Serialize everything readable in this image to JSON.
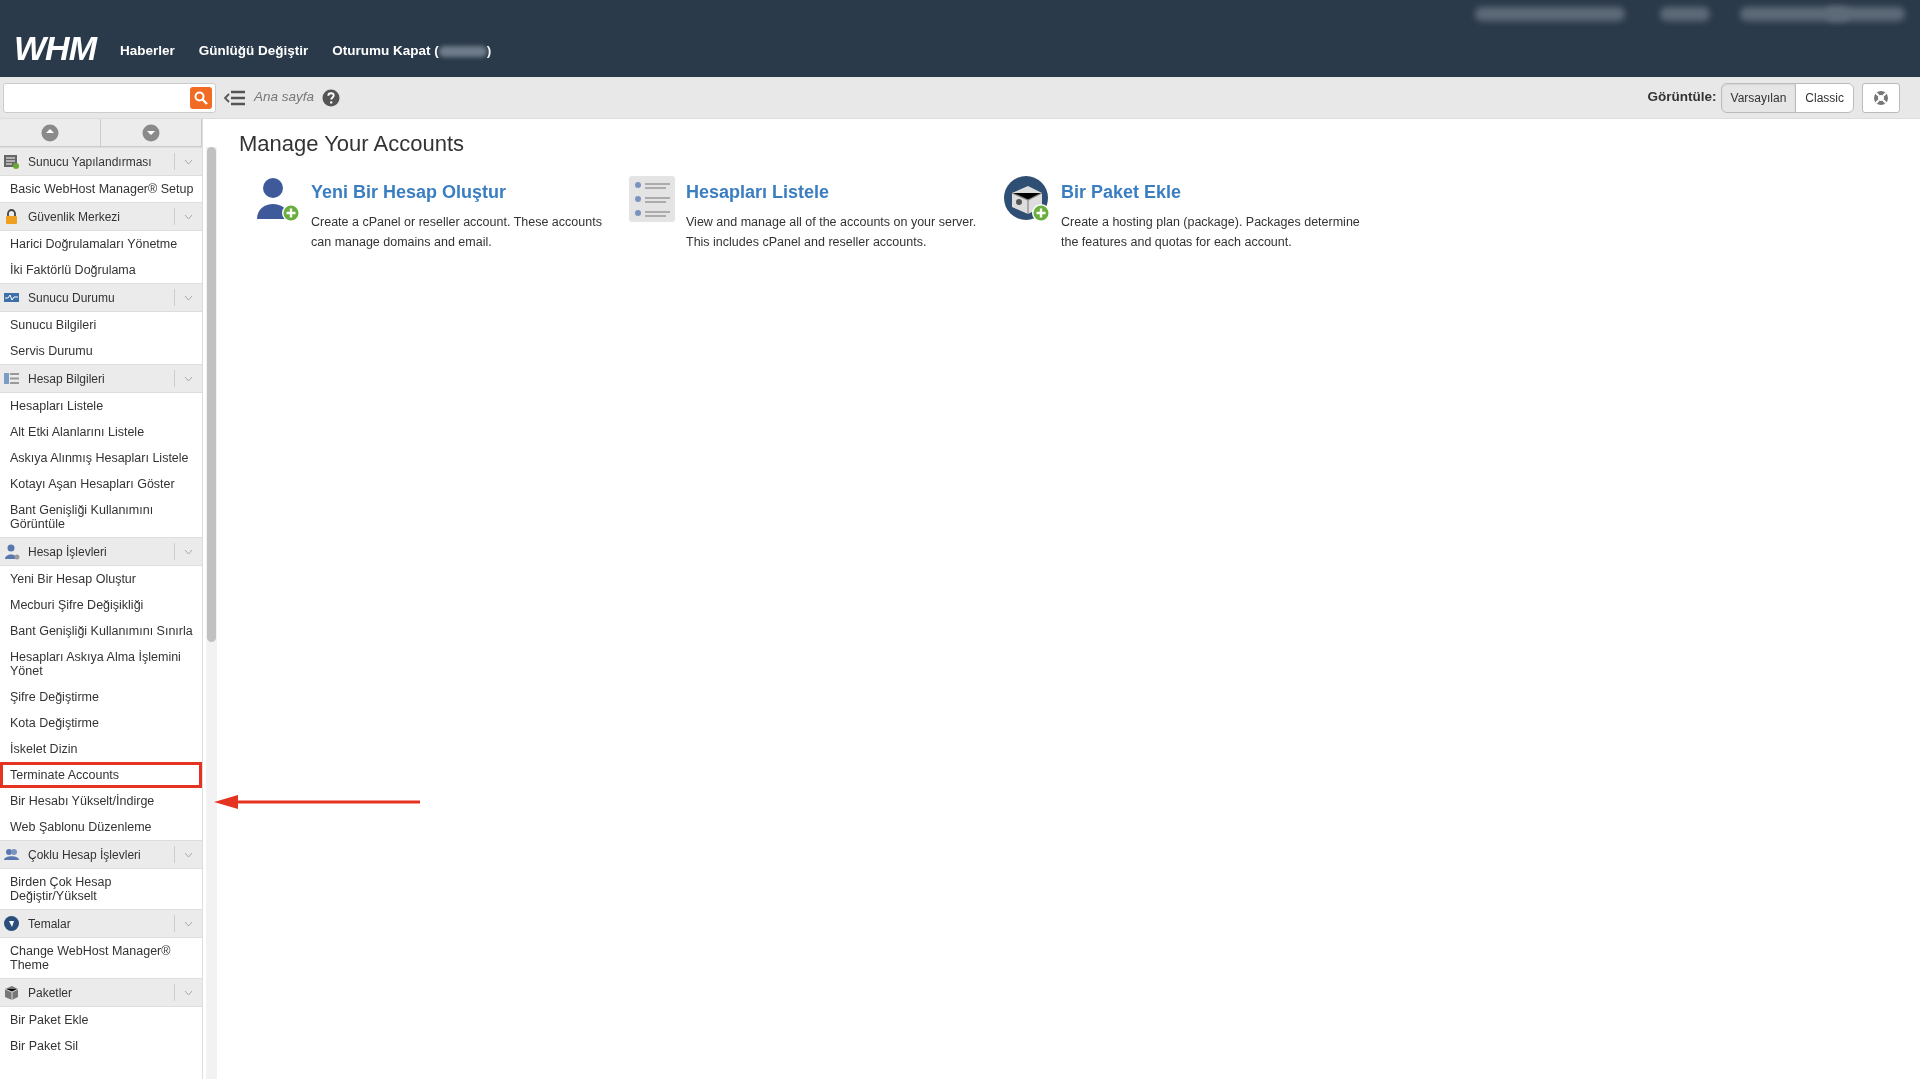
{
  "header": {
    "logo": "WHM",
    "nav": [
      "Haberler",
      "Günlüğü Değiştir"
    ],
    "logout_prefix": "Oturumu Kapat (",
    "logout_suffix": ")"
  },
  "toolbar": {
    "breadcrumb": "Ana sayfa",
    "view_label": "Görüntüle:",
    "view_options": [
      {
        "label": "Varsayılan",
        "selected": true
      },
      {
        "label": "Classic",
        "selected": false
      }
    ]
  },
  "sidebar": {
    "sections": [
      {
        "title": "Sunucu Yapılandırması",
        "items": [
          {
            "label": "Basic WebHost Manager® Setup",
            "highlighted": false
          }
        ]
      },
      {
        "title": "Güvenlik Merkezi",
        "items": [
          {
            "label": "Harici Doğrulamaları Yönetme",
            "highlighted": false
          },
          {
            "label": "İki Faktörlü Doğrulama",
            "highlighted": false
          }
        ]
      },
      {
        "title": "Sunucu Durumu",
        "items": [
          {
            "label": "Sunucu Bilgileri",
            "highlighted": false
          },
          {
            "label": "Servis Durumu",
            "highlighted": false
          }
        ]
      },
      {
        "title": "Hesap Bilgileri",
        "items": [
          {
            "label": "Hesapları Listele",
            "highlighted": false
          },
          {
            "label": "Alt Etki Alanlarını Listele",
            "highlighted": false
          },
          {
            "label": "Askıya Alınmış Hesapları Listele",
            "highlighted": false
          },
          {
            "label": "Kotayı Aşan Hesapları Göster",
            "highlighted": false
          },
          {
            "label": "Bant Genişliği Kullanımını Görüntüle",
            "highlighted": false
          }
        ]
      },
      {
        "title": "Hesap İşlevleri",
        "items": [
          {
            "label": "Yeni Bir Hesap Oluştur",
            "highlighted": false
          },
          {
            "label": "Mecburi Şifre Değişikliği",
            "highlighted": false
          },
          {
            "label": "Bant Genişliği Kullanımını Sınırla",
            "highlighted": false
          },
          {
            "label": "Hesapları Askıya Alma İşlemini Yönet",
            "highlighted": false
          },
          {
            "label": "Şifre Değiştirme",
            "highlighted": false
          },
          {
            "label": "Kota Değiştirme",
            "highlighted": false
          },
          {
            "label": "İskelet Dizin",
            "highlighted": false
          },
          {
            "label": "Terminate Accounts",
            "highlighted": true
          },
          {
            "label": "Bir Hesabı Yükselt/İndirge",
            "highlighted": false
          },
          {
            "label": "Web Şablonu Düzenleme",
            "highlighted": false
          }
        ]
      },
      {
        "title": "Çoklu Hesap İşlevleri",
        "items": [
          {
            "label": "Birden Çok Hesap Değiştir/Yükselt",
            "highlighted": false
          }
        ]
      },
      {
        "title": "Temalar",
        "items": [
          {
            "label": "Change WebHost Manager® Theme",
            "highlighted": false
          }
        ]
      },
      {
        "title": "Paketler",
        "items": [
          {
            "label": "Bir Paket Ekle",
            "highlighted": false
          },
          {
            "label": "Bir Paket Sil",
            "highlighted": false
          }
        ]
      }
    ]
  },
  "main": {
    "title": "Manage Your Accounts",
    "cards": [
      {
        "kind": "user",
        "title": "Yeni Bir Hesap Oluştur",
        "description": "Create a cPanel or reseller account. These accounts can manage domains and email."
      },
      {
        "kind": "list",
        "title": "Hesapları Listele",
        "description": "View and manage all of the accounts on your server. This includes cPanel and reseller accounts."
      },
      {
        "kind": "package",
        "title": "Bir Paket Ekle",
        "description": "Create a hosting plan (package). Packages determine the features and quotas for each account."
      }
    ]
  }
}
